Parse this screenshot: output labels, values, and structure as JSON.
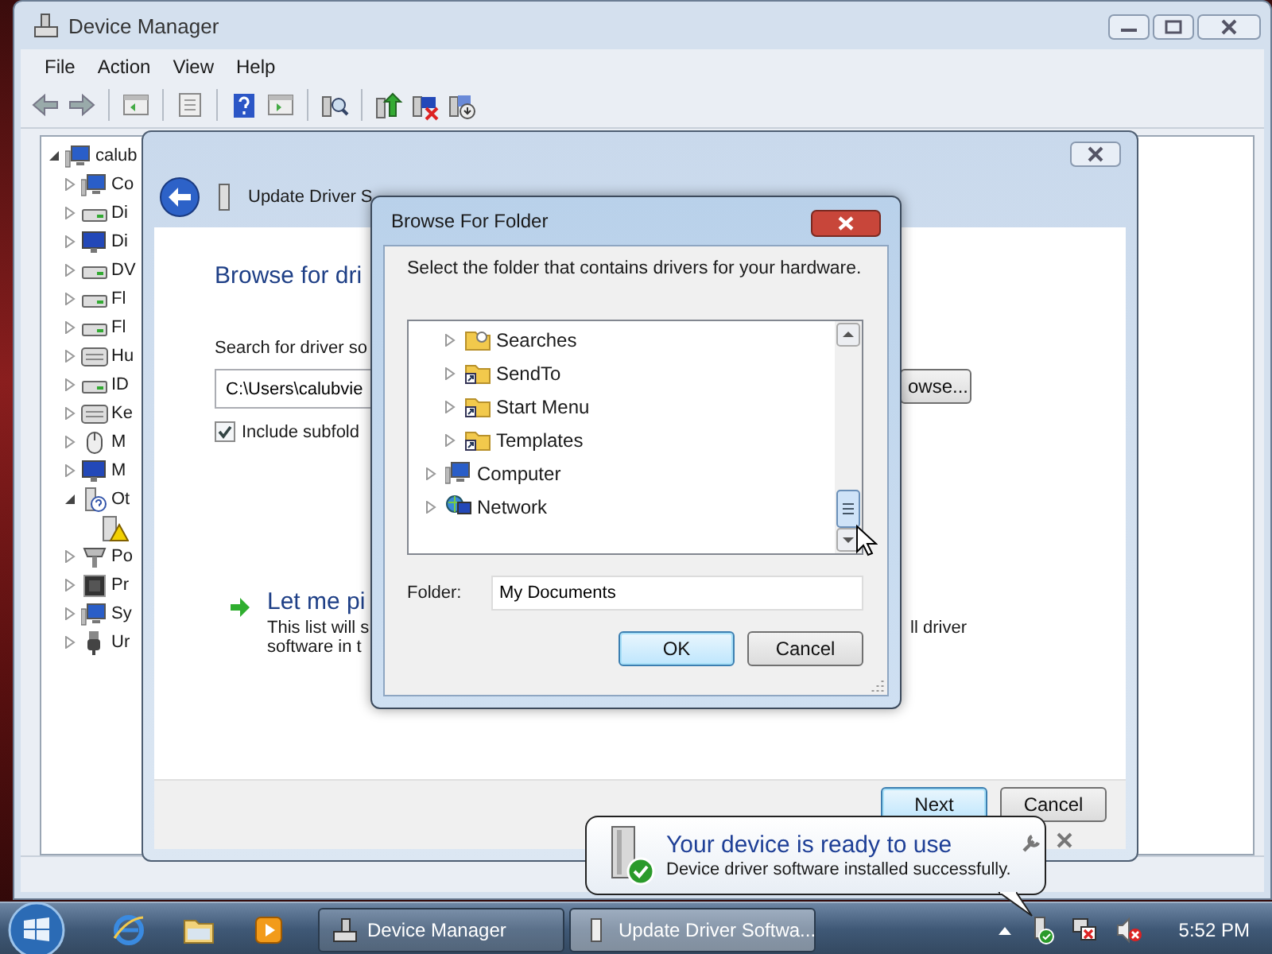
{
  "device_manager": {
    "title": "Device Manager",
    "menu": [
      "File",
      "Action",
      "View",
      "Help"
    ],
    "tree": {
      "label": "calub",
      "kind": "computer",
      "expanded": true,
      "children": [
        {
          "label": "Co",
          "kind": "computer",
          "expanded": false
        },
        {
          "label": "Di",
          "kind": "drive",
          "expanded": false
        },
        {
          "label": "Di",
          "kind": "display",
          "expanded": false
        },
        {
          "label": "DV",
          "kind": "drive",
          "expanded": false
        },
        {
          "label": "Fl",
          "kind": "drive",
          "expanded": false
        },
        {
          "label": "Fl",
          "kind": "drive",
          "expanded": false
        },
        {
          "label": "Hu",
          "kind": "keyboard",
          "expanded": false
        },
        {
          "label": "ID",
          "kind": "drive",
          "expanded": false
        },
        {
          "label": "Ke",
          "kind": "keyboard",
          "expanded": false
        },
        {
          "label": "M",
          "kind": "mouse",
          "expanded": false
        },
        {
          "label": "M",
          "kind": "display",
          "expanded": false
        },
        {
          "label": "Ot",
          "kind": "unknown",
          "expanded": true,
          "children": [
            {
              "kind": "warning"
            }
          ]
        },
        {
          "label": "Po",
          "kind": "port",
          "expanded": false
        },
        {
          "label": "Pr",
          "kind": "chip",
          "expanded": false
        },
        {
          "label": "Sy",
          "kind": "computer",
          "expanded": false
        },
        {
          "label": "Ur",
          "kind": "usb",
          "expanded": false
        }
      ]
    }
  },
  "update_driver": {
    "title": "Update Driver S",
    "heading": "Browse for dri",
    "search_label": "Search for driver so",
    "path": "C:\\Users\\calubvie",
    "browse_button": "owse...",
    "include_subfolders": {
      "label": "Include subfold",
      "checked": true
    },
    "pick_option": {
      "title": "Let me pi",
      "line_1": "This list will s",
      "line_1_end": "ll driver",
      "line_2": "software in t"
    },
    "buttons": [
      {
        "label": "Next",
        "default": true
      },
      {
        "label": "Cancel",
        "default": false
      }
    ]
  },
  "browse_for_folder": {
    "title": "Browse For Folder",
    "prompt": "Select the folder that contains drivers for your hardware.",
    "folders": [
      {
        "children": [
          {
            "label": "Searches",
            "kind": "search",
            "expanded": false
          },
          {
            "label": "SendTo",
            "kind": "shortcut",
            "expanded": false
          },
          {
            "label": "Start Menu",
            "kind": "shortcut",
            "expanded": false
          },
          {
            "label": "Templates",
            "kind": "shortcut",
            "expanded": false
          }
        ]
      },
      {
        "label": "Computer",
        "kind": "computer",
        "expanded": false
      },
      {
        "label": "Network",
        "kind": "network",
        "expanded": false
      }
    ],
    "folder_label": "Folder:",
    "folder_value": "My Documents",
    "buttons": [
      {
        "label": "OK",
        "default": true
      },
      {
        "label": "Cancel",
        "default": false
      }
    ]
  },
  "notification": {
    "title": "Your device is ready to use",
    "message": "Device driver software installed successfully."
  },
  "taskbar": {
    "pinned": [
      {
        "kind": "browser"
      },
      {
        "kind": "folder"
      },
      {
        "kind": "media"
      }
    ],
    "tasks": [
      {
        "label": "Device Manager",
        "kind": "device_manager",
        "selected": false
      },
      {
        "label": "Update Driver Softwa...",
        "kind": "driver",
        "selected": true
      }
    ],
    "clock": "5:52 PM"
  }
}
